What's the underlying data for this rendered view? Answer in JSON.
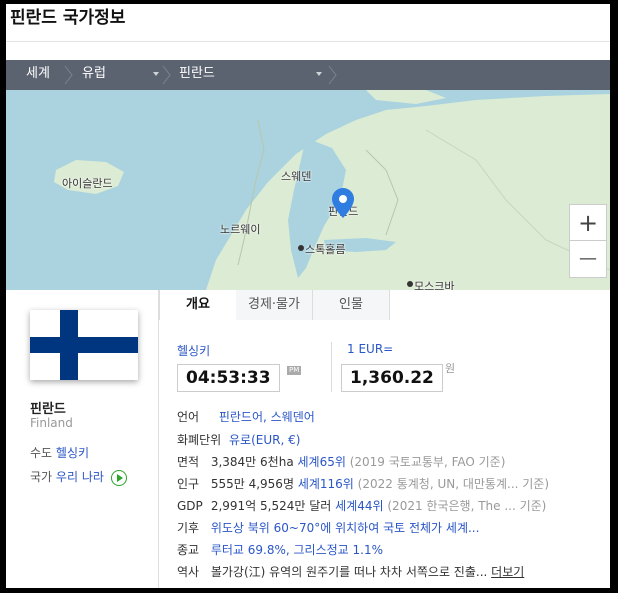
{
  "title": "핀란드 국가정보",
  "breadcrumb": {
    "level1": "세계",
    "level2": "유럽",
    "level3": "핀란드"
  },
  "map": {
    "labels": {
      "iceland": "아이슬란드",
      "sweden": "스웨덴",
      "norway": "노르웨이",
      "finland": "핀란드",
      "stockholm": "스톡홀름",
      "moscow": "모스크바"
    },
    "zoom_in": "+",
    "zoom_out": "—"
  },
  "country": {
    "name": "핀란드",
    "name_en": "Finland",
    "capital_label": "수도",
    "capital": "헬싱키",
    "anthem_label": "국가",
    "anthem": "우리 나라"
  },
  "tabs": [
    {
      "label": "개요",
      "active": true
    },
    {
      "label": "경제·물가",
      "active": false
    },
    {
      "label": "인물",
      "active": false
    }
  ],
  "time": {
    "city": "헬싱키",
    "value": "04:53:33",
    "period": "PM"
  },
  "currency": {
    "label": "1 EUR=",
    "value": "1,360.22",
    "unit": "원"
  },
  "facts": [
    {
      "key": "언어",
      "value": "핀란드어, 스웨덴어"
    },
    {
      "key": "화폐단위",
      "value": "유로(EUR, €)"
    },
    {
      "key": "면적",
      "value": "3,384만 6천ha",
      "rank": "세계65위",
      "source": "(2019 국토교통부, FAO 기준)"
    },
    {
      "key": "인구",
      "value": "555만 4,956명",
      "rank": "세계116위",
      "source": "(2022 통계청, UN, 대만통계... 기준)"
    },
    {
      "key": "GDP",
      "value": "2,991억 5,524만 달러",
      "rank": "세계44위",
      "source": "(2021 한국은행, The ... 기준)"
    },
    {
      "key": "기후",
      "value": "위도상 북위 60~70°에 위치하여 국토 전체가 세계..."
    },
    {
      "key": "종교",
      "value": "루터교 69.8%, 그리스정교 1.1%"
    },
    {
      "key": "역사",
      "value": "볼가강(江) 유역의 원주기를 떠나 차차 서쪽으로 진출...",
      "more": "더보기"
    }
  ],
  "colors": {
    "breadcrumb_bg": "#5b6270",
    "link": "#2a56c6",
    "flag_blue": "#003580",
    "map_water": "#aad3df",
    "map_land": "#dcebd3"
  }
}
